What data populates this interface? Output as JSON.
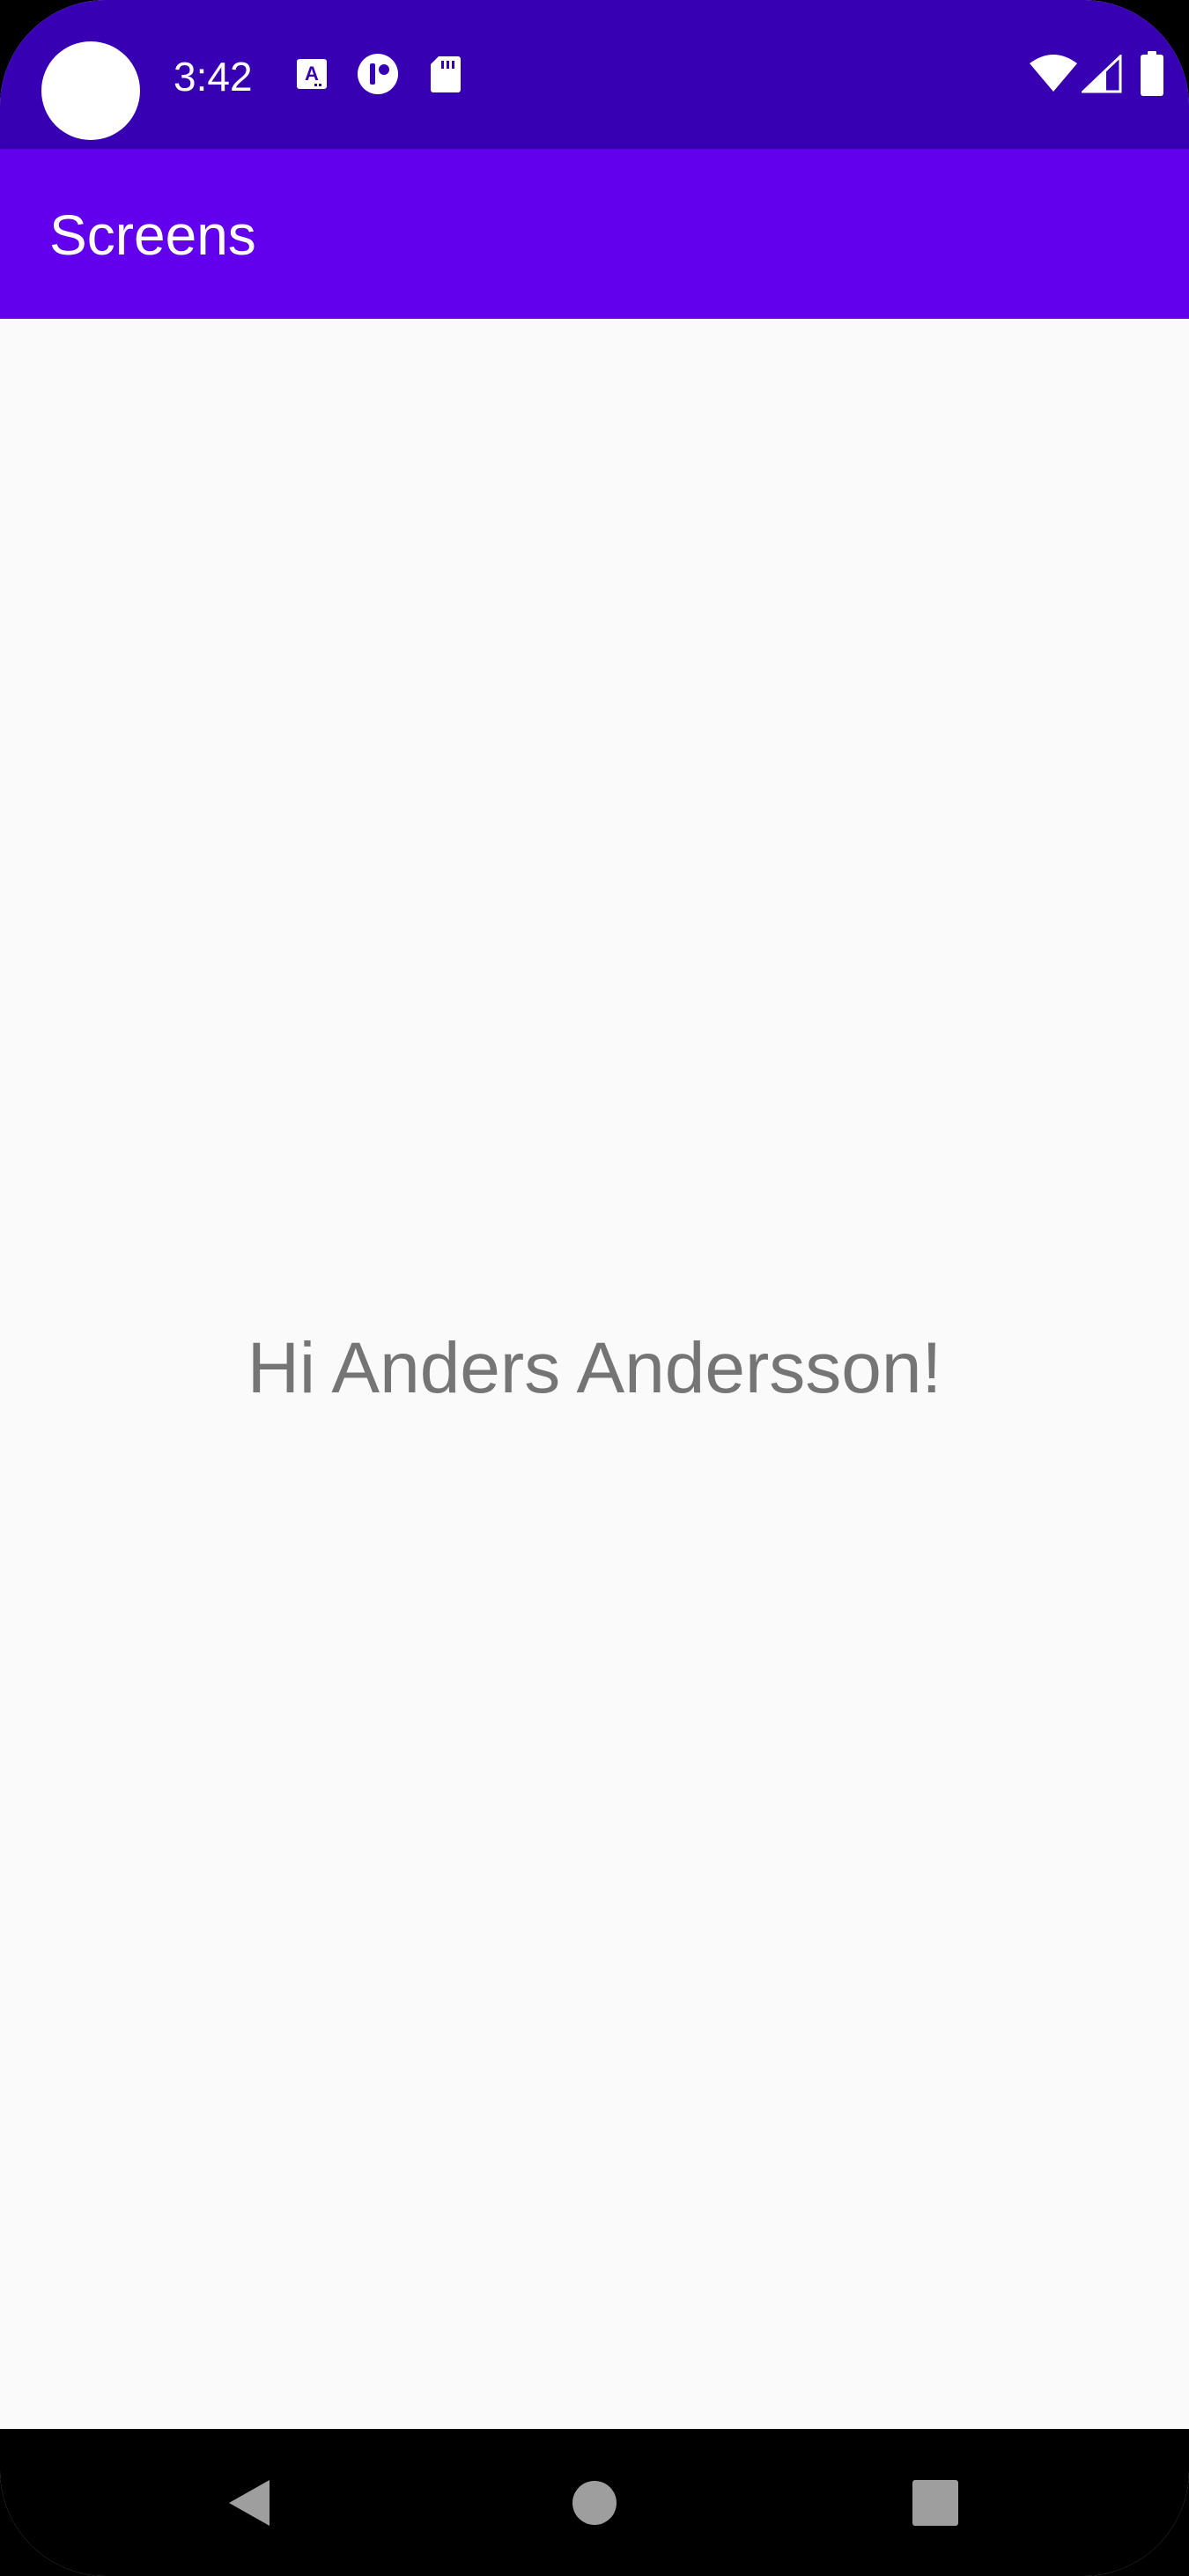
{
  "status_bar": {
    "time": "3:42",
    "icons": [
      "camera-cutout",
      "translate-icon",
      "app-notification-icon",
      "sd-card-icon",
      "wifi-icon",
      "cellular-signal-icon",
      "battery-icon"
    ],
    "background": "#3700b3"
  },
  "app_bar": {
    "title": "Screens",
    "background": "#6200ee"
  },
  "main": {
    "greeting": "Hi Anders Andersson!"
  },
  "nav_bar": {
    "buttons": [
      "back-icon",
      "home-icon",
      "recents-icon"
    ]
  }
}
